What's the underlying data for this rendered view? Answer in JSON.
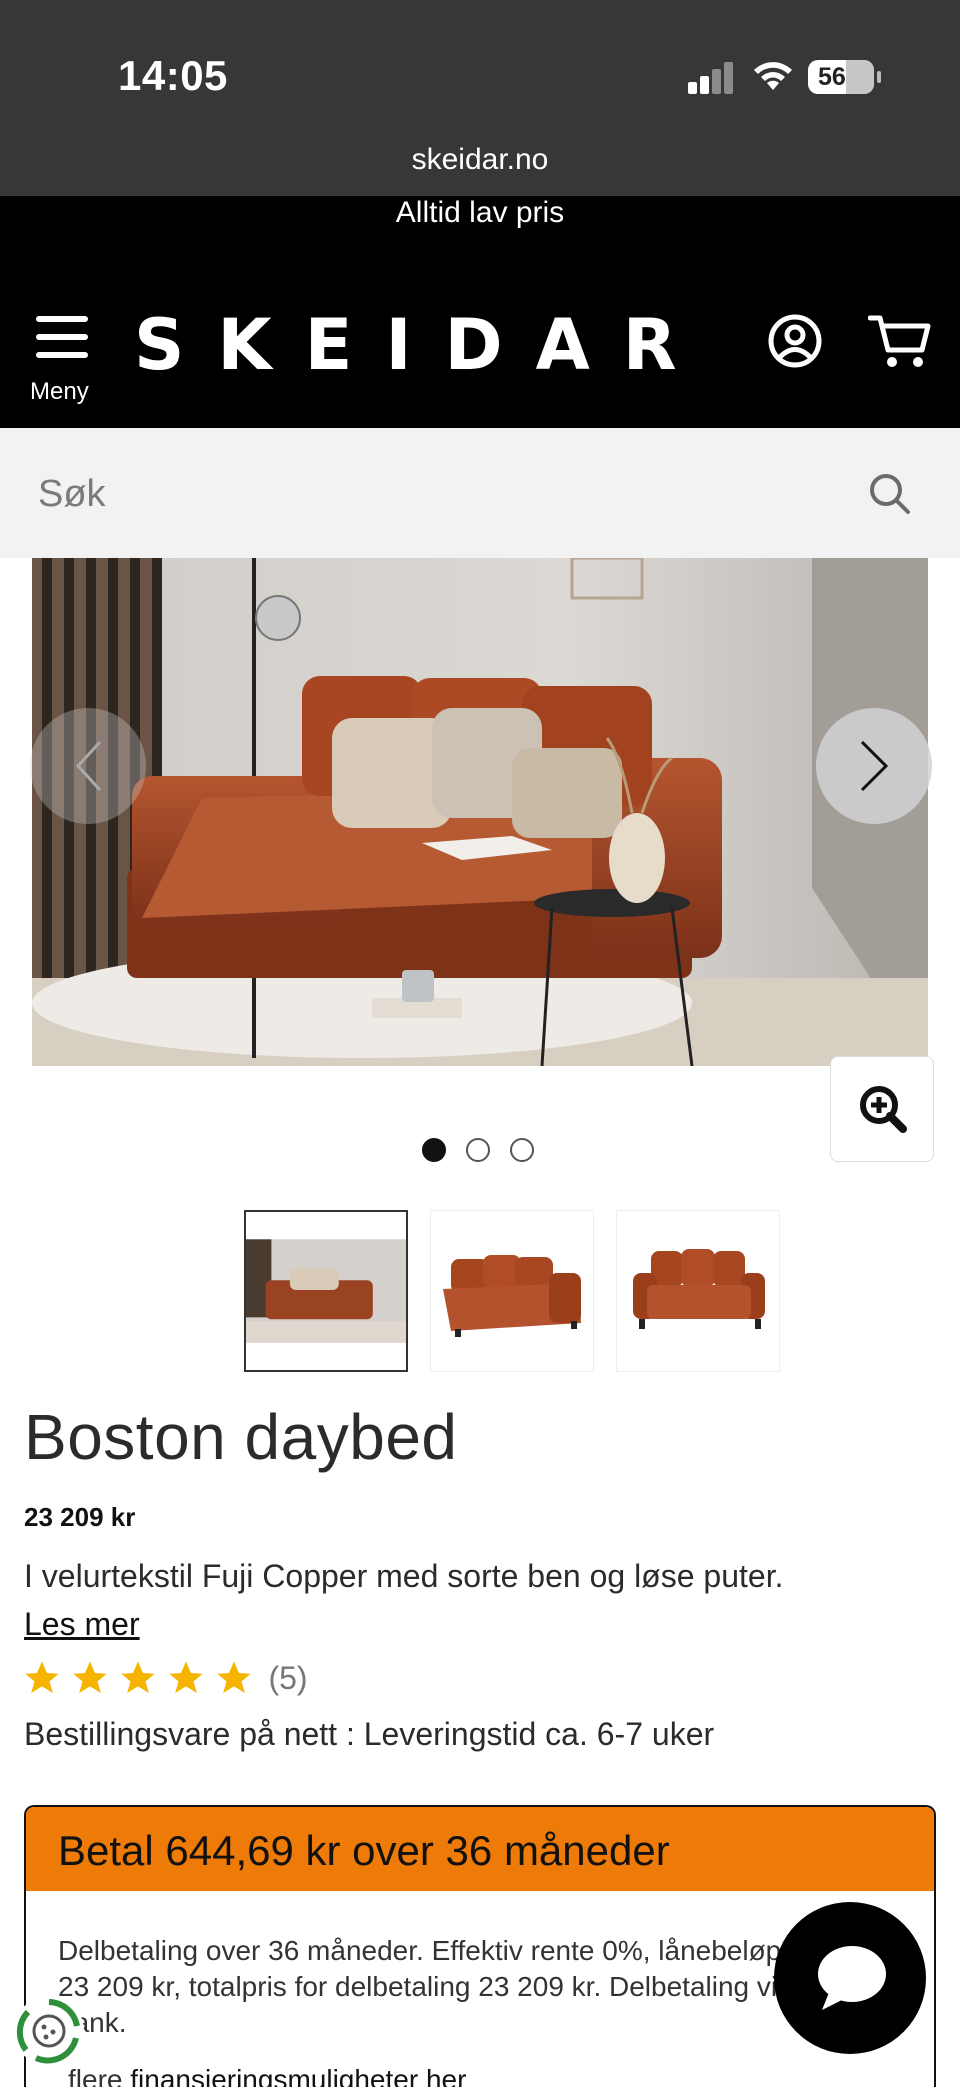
{
  "status_bar": {
    "time": "14:05",
    "battery": "56",
    "url": "skeidar.no"
  },
  "header": {
    "banner_text": "Alltid lav pris",
    "menu_label": "Meny",
    "logo_text": "SKEIDAR",
    "icons": [
      "menu-icon",
      "user-icon",
      "cart-icon"
    ]
  },
  "search": {
    "placeholder": "Søk"
  },
  "gallery": {
    "dot_count": 3,
    "active_dot": 0,
    "icons": [
      "chevron-left-icon",
      "chevron-right-icon",
      "zoom-in-icon"
    ]
  },
  "product": {
    "title": "Boston daybed",
    "price": "23 209 kr",
    "description": "I velurtekstil Fuji Copper med sorte ben og løse puter.",
    "read_more": "Les mer",
    "rating": 5,
    "review_count": "(5)",
    "delivery": "Bestillingsvare på nett : Leveringstid ca. 6-7 uker"
  },
  "payment": {
    "title": "Betal 644,69 kr over 36 måneder",
    "body": "Delbetaling over 36 måneder. Effektiv rente 0%, lånebeløp 23 209 kr, totalpris for delbetaling 23 209 kr. Delbetaling via bank.",
    "link_prefix": "flere",
    "link_text": "finansieringsmuligheter her"
  },
  "colors": {
    "accent_orange": "#ee7a07",
    "star_yellow": "#f5b400",
    "header_black": "#000000",
    "status_bar": "#353739"
  }
}
